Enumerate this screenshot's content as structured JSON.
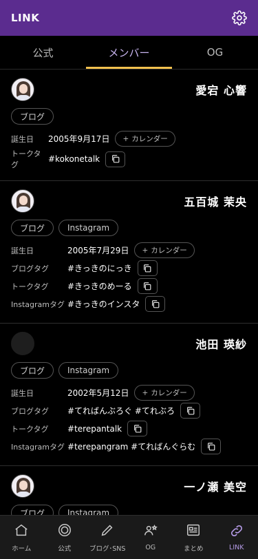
{
  "app": {
    "title": "LINK"
  },
  "tabs": [
    {
      "label": "公式"
    },
    {
      "label": "メンバー"
    },
    {
      "label": "OG"
    }
  ],
  "active_tab": "メンバー",
  "members": [
    {
      "name": "愛宕 心響",
      "chips": [
        "ブログ"
      ],
      "rows": [
        {
          "label": "誕生日",
          "value": "2005年9月17日",
          "action": "calendar"
        },
        {
          "label": "トークタグ",
          "value": "#kokonetalk",
          "action": "copy"
        }
      ]
    },
    {
      "name": "五百城 茉央",
      "chips": [
        "ブログ",
        "Instagram"
      ],
      "rows": [
        {
          "label": "誕生日",
          "value": "2005年7月29日",
          "action": "calendar"
        },
        {
          "label": "ブログタグ",
          "value": "#きっきのにっき",
          "action": "copy"
        },
        {
          "label": "トークタグ",
          "value": "#きっきのめーる",
          "action": "copy"
        },
        {
          "label": "Instagramタグ",
          "value": "#きっきのインスタ",
          "action": "copy"
        }
      ]
    },
    {
      "name": "池田 瑛紗",
      "chips": [
        "ブログ",
        "Instagram"
      ],
      "rows": [
        {
          "label": "誕生日",
          "value": "2002年5月12日",
          "action": "calendar"
        },
        {
          "label": "ブログタグ",
          "value": "#てればんぶろぐ #てれぶろ",
          "action": "copy"
        },
        {
          "label": "トークタグ",
          "value": "#terepantalk",
          "action": "copy"
        },
        {
          "label": "Instagramタグ",
          "value": "#terepangram #てればんぐらむ",
          "action": "copy"
        }
      ]
    },
    {
      "name": "一ノ瀬 美空",
      "chips": [
        "ブログ",
        "Instagram"
      ],
      "rows": []
    }
  ],
  "calendar_button_label": "カレンダー",
  "bottom_nav": [
    {
      "label": "ホーム",
      "icon": "home-icon"
    },
    {
      "label": "公式",
      "icon": "circle-icon"
    },
    {
      "label": "ブログ･SNS",
      "icon": "pencil-icon"
    },
    {
      "label": "OG",
      "icon": "people-star-icon"
    },
    {
      "label": "まとめ",
      "icon": "newspaper-icon"
    },
    {
      "label": "LINK",
      "icon": "link-icon"
    }
  ],
  "active_nav": "LINK",
  "colors": {
    "header": "#5b2c8f",
    "tab_indicator": "#f2c14e",
    "active_tab_text": "#c8b4ef",
    "active_nav": "#b69ce8"
  }
}
